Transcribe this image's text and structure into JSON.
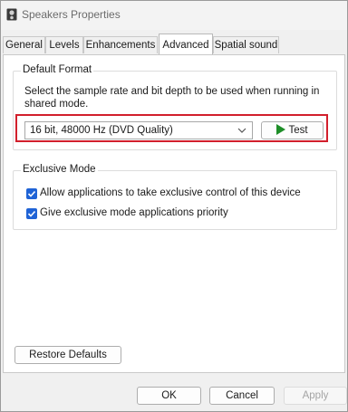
{
  "window": {
    "title": "Speakers Properties"
  },
  "tabs": [
    {
      "label": "General"
    },
    {
      "label": "Levels"
    },
    {
      "label": "Enhancements"
    },
    {
      "label": "Advanced"
    },
    {
      "label": "Spatial sound"
    }
  ],
  "active_tab": "Advanced",
  "default_format": {
    "legend": "Default Format",
    "description": "Select the sample rate and bit depth to be used when running in shared mode.",
    "selected_format": "16 bit, 48000 Hz (DVD Quality)",
    "test_label": "Test"
  },
  "exclusive_mode": {
    "legend": "Exclusive Mode",
    "options": [
      {
        "label": "Allow applications to take exclusive control of this device",
        "checked": true
      },
      {
        "label": "Give exclusive mode applications priority",
        "checked": true
      }
    ]
  },
  "buttons": {
    "restore_defaults": "Restore Defaults",
    "ok": "OK",
    "cancel": "Cancel",
    "apply": "Apply"
  },
  "colors": {
    "accent": "#1f63d6",
    "highlight_box": "#d21f2c",
    "play_icon": "#1e8e28"
  }
}
